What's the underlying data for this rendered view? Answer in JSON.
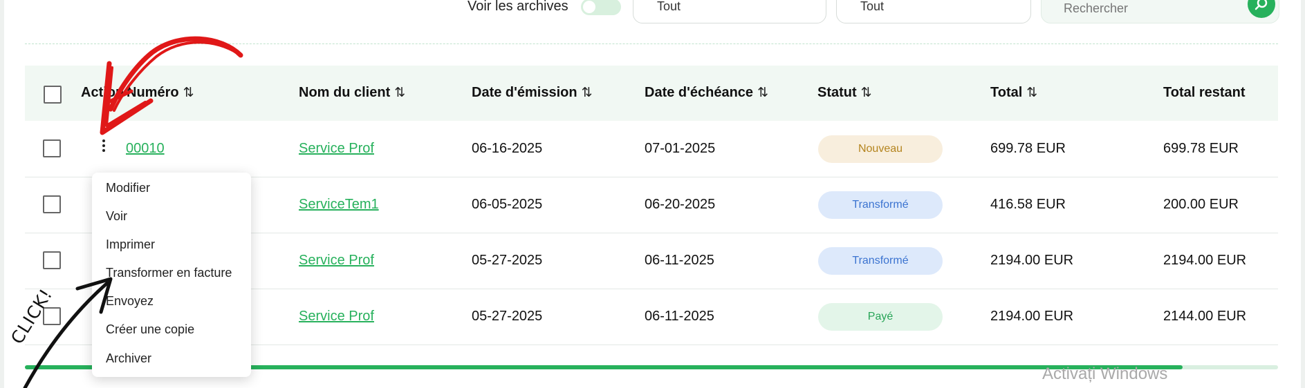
{
  "filters": {
    "archives_label": "Voir les archives",
    "archives_toggle_on": true,
    "select_1_value": "Tout",
    "select_2_value": "Tout",
    "search_placeholder": "Rechercher"
  },
  "table": {
    "headers": {
      "action": "Action",
      "numero": "Numéro",
      "client": "Nom du client",
      "emission": "Date d'émission",
      "echeance": "Date d'échéance",
      "statut": "Statut",
      "total": "Total",
      "restant": "Total restant"
    },
    "sort_glyph": "⇅",
    "rows": [
      {
        "numero": "00010",
        "client": "Service Prof",
        "emission": "06-16-2025",
        "echeance": "07-01-2025",
        "statut": "Nouveau",
        "total": "699.78 EUR",
        "restant": "699.78 EUR"
      },
      {
        "numero": "",
        "client": "ServiceTem1",
        "emission": "06-05-2025",
        "echeance": "06-20-2025",
        "statut": "Transformé",
        "total": "416.58 EUR",
        "restant": "200.00 EUR"
      },
      {
        "numero": "",
        "client": "Service Prof",
        "emission": "05-27-2025",
        "echeance": "06-11-2025",
        "statut": "Transformé",
        "total": "2194.00 EUR",
        "restant": "2194.00 EUR"
      },
      {
        "numero": "",
        "client": "Service Prof",
        "emission": "05-27-2025",
        "echeance": "06-11-2025",
        "statut": "Payé",
        "total": "2194.00 EUR",
        "restant": "2144.00 EUR"
      }
    ]
  },
  "status_colors": {
    "Nouveau": {
      "bg": "#f8eedd",
      "fg": "#b4841e"
    },
    "Transformé": {
      "bg": "#dde9fb",
      "fg": "#3b73d0"
    },
    "Payé": {
      "bg": "#e3f5e9",
      "fg": "#27a457"
    }
  },
  "action_menu": {
    "items": [
      "Modifier",
      "Voir",
      "Imprimer",
      "Transformer en facture",
      "Envoyez",
      "Créer une copie",
      "Archiver"
    ]
  },
  "scroll_progress": 0.92,
  "watermark": "Activați Windows",
  "annotation_text": "CLICK!",
  "accent_color": "#27b15c"
}
